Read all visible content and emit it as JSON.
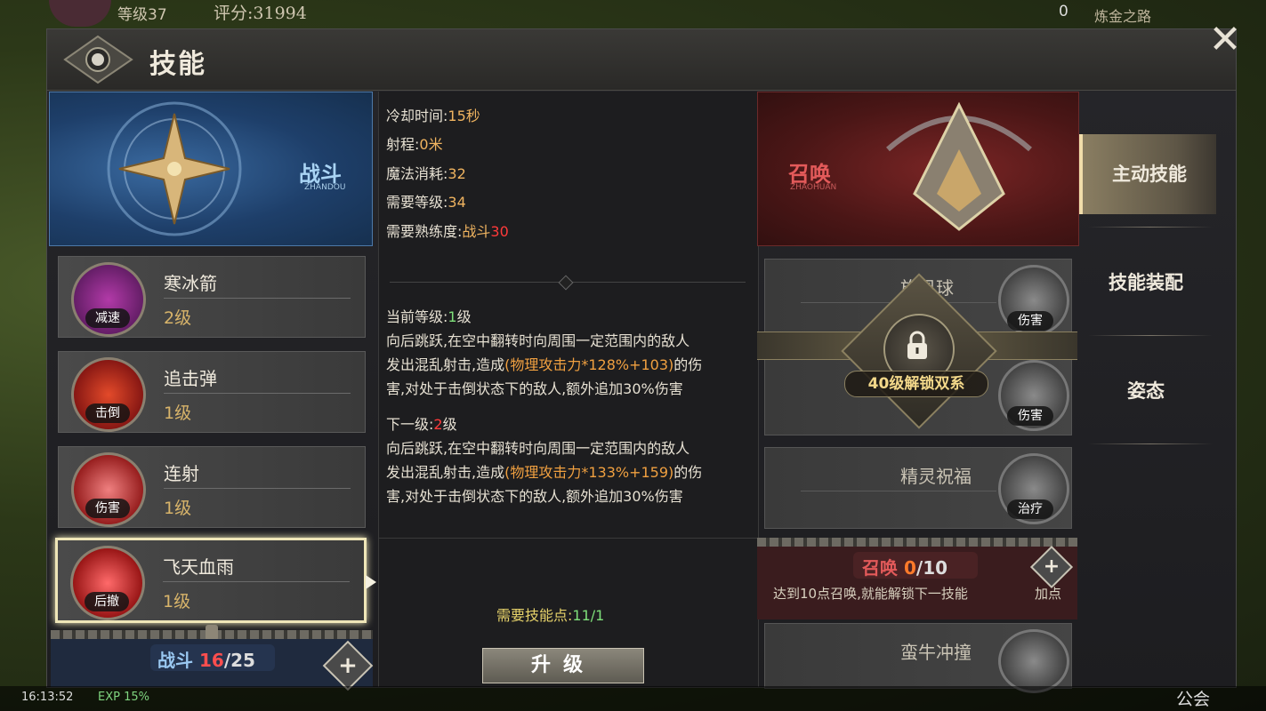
{
  "topbar": {
    "level": "等级37",
    "score": "评分:31994",
    "count": "0",
    "alchemy": "炼金之路"
  },
  "title": "技能",
  "close_icon": "close-icon",
  "left_school": {
    "name": "战斗",
    "pinyin": "ZHANDOU"
  },
  "skills": [
    {
      "name": "寒冰箭",
      "level": "2级",
      "tag": "减速"
    },
    {
      "name": "追击弹",
      "level": "1级",
      "tag": "击倒"
    },
    {
      "name": "连射",
      "level": "1级",
      "tag": "伤害"
    },
    {
      "name": "飞天血雨",
      "level": "1级",
      "tag": "后撤"
    }
  ],
  "left_progress": {
    "label": "战斗 ",
    "current": "16",
    "total": "/25"
  },
  "stats": {
    "cooldown_label": "冷却时间:",
    "cooldown_value": "15秒",
    "range_label": "射程:",
    "range_value": "0米",
    "mana_label": "魔法消耗:",
    "mana_value": "32",
    "req_level_label": "需要等级:",
    "req_level_value": "34",
    "req_prof_label": "需要熟练度:",
    "req_prof_school": "战斗",
    "req_prof_value": "30"
  },
  "current": {
    "label": "当前等级:",
    "level": "1",
    "unit": "级",
    "d1": "向后跳跃,在空中翻转时向周围一定范围内的敌人",
    "d2a": "发出混乱射击,造成",
    "d2b": "(物理攻击力*128%+103)",
    "d2c": "的伤",
    "d3": "害,对处于击倒状态下的敌人,额外追加30%伤害"
  },
  "next": {
    "label": "下一级:",
    "level": "2",
    "unit": "级",
    "d1": "向后跳跃,在空中翻转时向周围一定范围内的敌人",
    "d2a": "发出混乱射击,造成",
    "d2b": "(物理攻击力*133%+159)",
    "d2c": "的伤",
    "d3": "害,对处于击倒状态下的敌人,额外追加30%伤害"
  },
  "need_points": {
    "label": "需要技能点:",
    "value": "11/1"
  },
  "upgrade_label": "升级",
  "right_school": {
    "name": "召唤",
    "pinyin": "ZHAOHUAN"
  },
  "right_skills": [
    {
      "name": "旋风球",
      "tag": "伤害"
    },
    {
      "name": "",
      "tag": "伤害"
    },
    {
      "name": "精灵祝福",
      "tag": "治疗"
    },
    {
      "name": "蛮牛冲撞",
      "tag": ""
    }
  ],
  "lock_text": "40级解锁双系",
  "summon_progress": {
    "label": "召唤 ",
    "current": "0",
    "total": "/10"
  },
  "summon_hint": "达到10点召唤,就能解锁下一技能",
  "plus_label": "加点",
  "tabs": [
    "主动技能",
    "技能装配",
    "姿态"
  ],
  "hud": {
    "time": "16:13:52",
    "exp": "EXP 15%",
    "guild": "公会"
  },
  "colors": {
    "combat_blue": "#3a6aa0",
    "summon_red": "#7a2525",
    "accent_gold": "#f0b460",
    "active_tab": "#8a7e62"
  }
}
